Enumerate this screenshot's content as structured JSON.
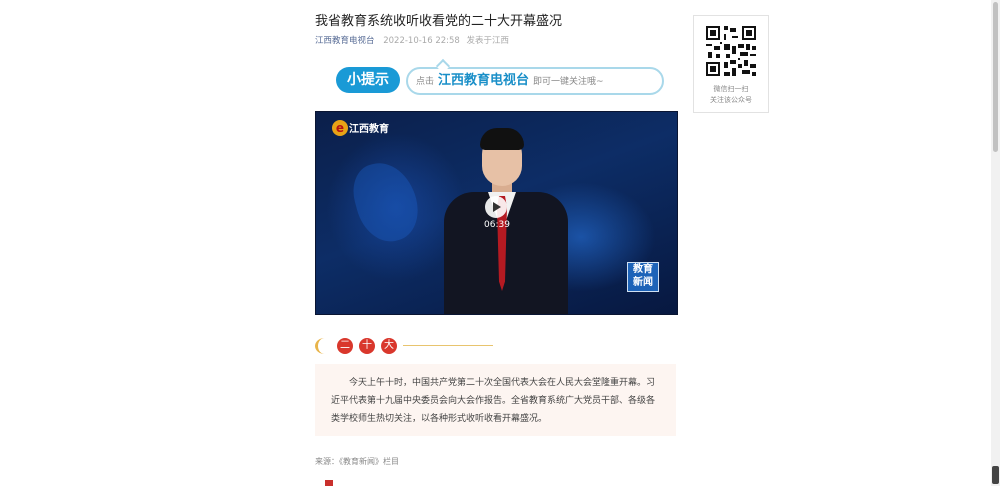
{
  "article": {
    "title": "我省教育系统收听收看党的二十大开幕盛况",
    "account": "江西教育电视台",
    "time": "2022-10-16 22:58",
    "location": "发表于江西"
  },
  "tip": {
    "badge": "小提示",
    "prefix": "点击",
    "name": "江西教育电视台",
    "suffix": "即可一键关注哦~"
  },
  "video": {
    "channel_logo": "江西教育",
    "duration": "06:39",
    "corner_badge_line1": "教育",
    "corner_badge_line2": "新闻",
    "play_icon": "play-icon"
  },
  "section": {
    "chars": [
      "二",
      "十",
      "大"
    ]
  },
  "intro": {
    "text": "今天上午十时，中国共产党第二十次全国代表大会在人民大会堂隆重开幕。习近平代表第十九届中央委员会向大会作报告。全省教育系统广大党员干部、各级各类学校师生热切关注，以各种形式收听收看开幕盛况。"
  },
  "source": "来源：《教育新闻》栏目",
  "qr": {
    "line1": "微信扫一扫",
    "line2": "关注该公众号"
  },
  "colors": {
    "accent_blue": "#1a9ad6",
    "section_red": "#d9372c",
    "intro_bg": "#fdf5f1",
    "account_link": "#576b95"
  }
}
